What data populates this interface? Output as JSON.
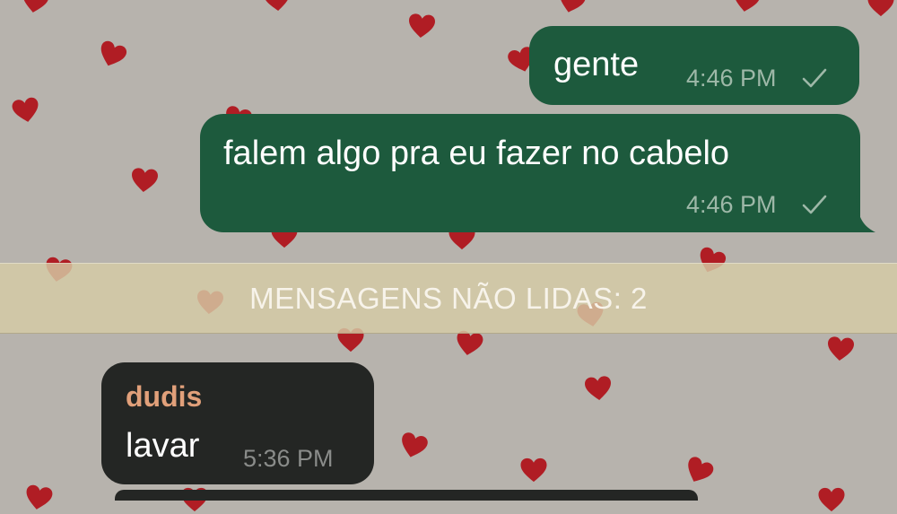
{
  "theme": {
    "wallpaper": "#b7b3ad",
    "heart_color": "#b01d24",
    "outgoing_bubble": "#1d5a3d",
    "incoming_bubble": "#242624",
    "sender_color": "#e1a07a",
    "unread_bar": "#d6cca6"
  },
  "messages": [
    {
      "direction": "outgoing",
      "text": "gente",
      "time": "4:46 PM",
      "status_icon": "check-icon"
    },
    {
      "direction": "outgoing",
      "text": "falem algo pra eu fazer no cabelo",
      "time": "4:46 PM",
      "status_icon": "check-icon"
    },
    {
      "direction": "incoming",
      "sender": "dudis",
      "text": "lavar",
      "time": "5:36 PM"
    }
  ],
  "unread_divider": {
    "label": "MENSAGENS NÃO LIDAS: 2"
  },
  "wallpaper_pattern": {
    "icon": "heart-icon"
  }
}
